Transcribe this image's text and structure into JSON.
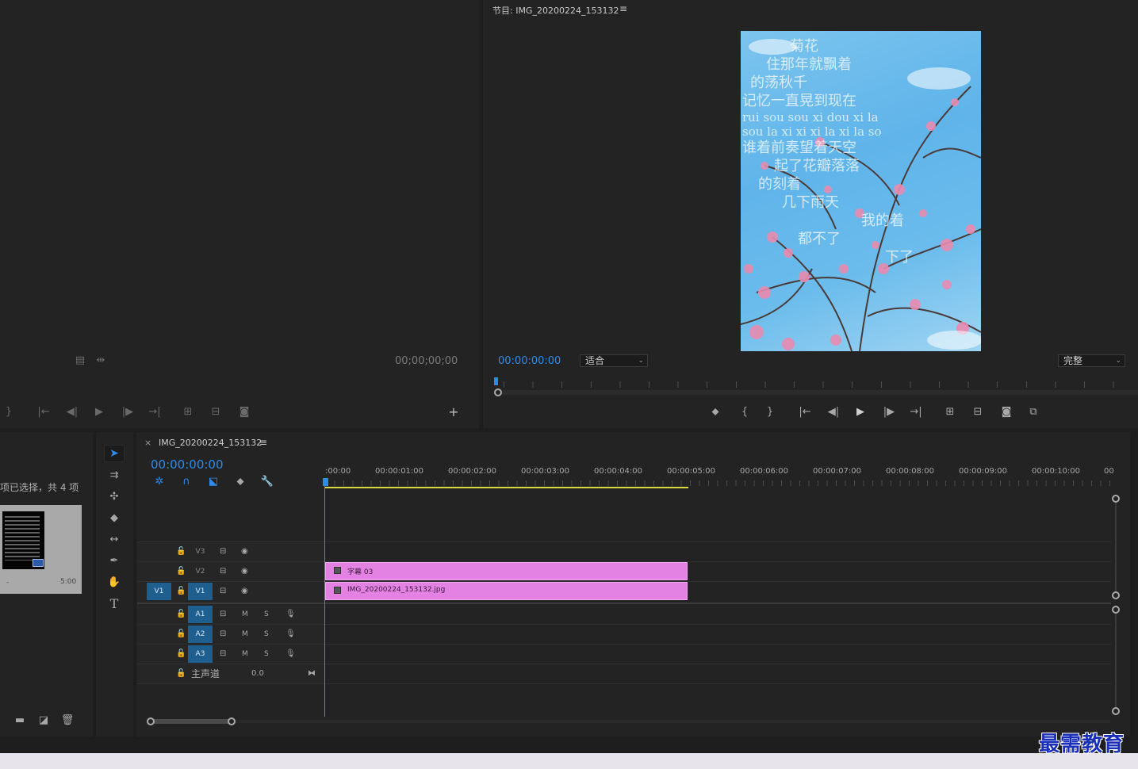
{
  "source_monitor": {
    "timecode": "00;00;00;00"
  },
  "program_monitor": {
    "title": "节目: IMG_20200224_153132",
    "menu_icon": "hamburger-icon",
    "timecode": "00:00:00:00",
    "fit_select": "适合",
    "quality_select": "完整",
    "poem_lines": [
      "菊花",
      "住那年就飘着",
      "的荡秋千",
      "记忆一直晃到现在",
      "rui sou sou xi dou xi la",
      "sou la xi xi xi la xi la so",
      "谁着前奏望着天空",
      "起了花瓣落落",
      "的刻着",
      "几下雨天",
      "我的着",
      "都不了",
      "下了"
    ]
  },
  "project_panel": {
    "selection_text": "项已选择，共 4 项",
    "thumb_duration": "5:00",
    "thumb_dash": "-"
  },
  "timeline": {
    "tab_close": "×",
    "sequence_name": "IMG_20200224_153132",
    "timecode": "00:00:00:00",
    "ruler_labels": [
      ":00:00",
      "00:00:01:00",
      "00:00:02:00",
      "00:00:03:00",
      "00:00:04:00",
      "00:00:05:00",
      "00:00:06:00",
      "00:00:07:00",
      "00:00:08:00",
      "00:00:09:00",
      "00:00:10:00",
      "00"
    ],
    "video_tracks": [
      {
        "name": "V3"
      },
      {
        "name": "V2"
      },
      {
        "name": "V1",
        "source": "V1"
      }
    ],
    "audio_tracks": [
      {
        "name": "A1",
        "m": "M",
        "s": "S"
      },
      {
        "name": "A2",
        "m": "M",
        "s": "S"
      },
      {
        "name": "A3",
        "m": "M",
        "s": "S"
      }
    ],
    "master": {
      "label": "主声道",
      "value": "0.0"
    },
    "clips": [
      {
        "name": "字幕 03"
      },
      {
        "name": "IMG_20200224_153132.jpg"
      }
    ]
  },
  "watermark": "最需教育"
}
